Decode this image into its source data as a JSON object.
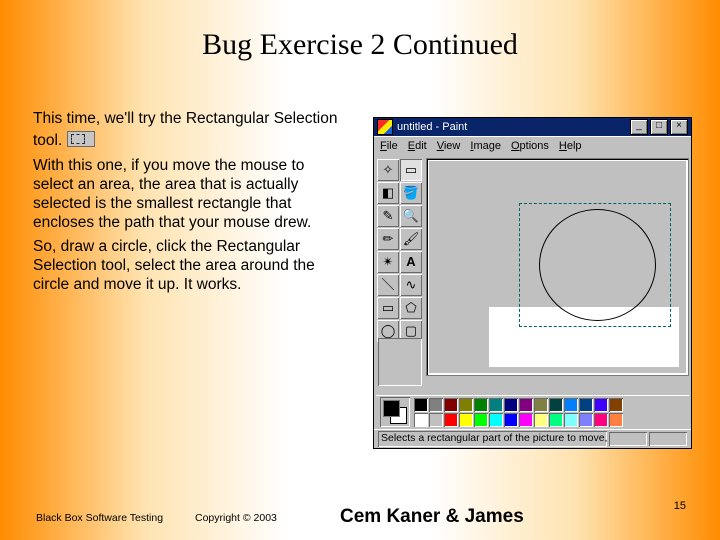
{
  "title": "Bug Exercise 2 Continued",
  "body": {
    "p1": "This time, we'll try the Rectangular Selection tool.",
    "p2": "With this one, if you move the mouse to select an area, the area that is actually selected is the smallest rectangle that encloses the path that your mouse drew.",
    "p3": "So, draw a circle, click the Rectangular Selection tool, select the area around the circle and move it up. It works."
  },
  "paint": {
    "window_title": "untitled - Paint",
    "menu": {
      "file": "File",
      "edit": "Edit",
      "view": "View",
      "image": "Image",
      "options": "Options",
      "help": "Help"
    },
    "status": "Selects a rectangular part of the picture to move, copy,"
  },
  "palette_colors_row1": [
    "#000000",
    "#808080",
    "#800000",
    "#808000",
    "#008000",
    "#008080",
    "#000080",
    "#800080",
    "#808040",
    "#004040",
    "#0080ff",
    "#004080",
    "#4000ff",
    "#804000"
  ],
  "palette_colors_row2": [
    "#ffffff",
    "#c0c0c0",
    "#ff0000",
    "#ffff00",
    "#00ff00",
    "#00ffff",
    "#0000ff",
    "#ff00ff",
    "#ffff80",
    "#00ff80",
    "#80ffff",
    "#8080ff",
    "#ff0080",
    "#ff8040"
  ],
  "footer": {
    "left": "Black Box Software Testing",
    "copyright": "Copyright ©  2003",
    "center": "Cem Kaner & James",
    "page": "15"
  }
}
